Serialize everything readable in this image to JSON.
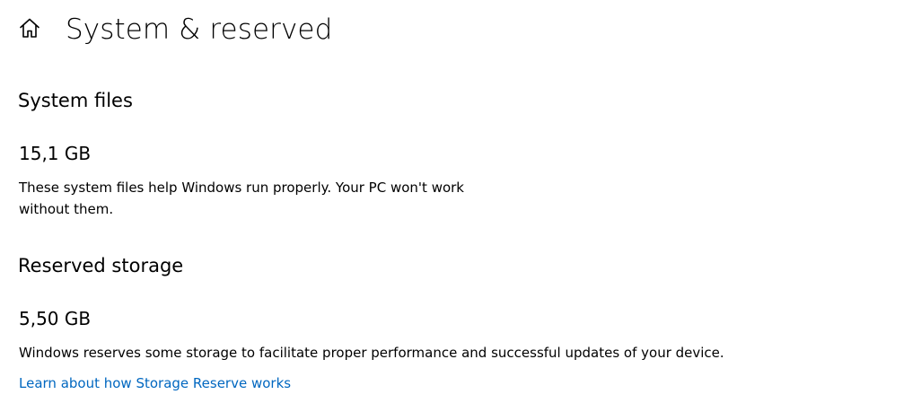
{
  "header": {
    "home_icon": "home-icon",
    "title": "System & reserved"
  },
  "system_files": {
    "title": "System files",
    "size": "15,1 GB",
    "description": "These system files help Windows run properly. Your PC won't work without them."
  },
  "reserved_storage": {
    "title": "Reserved storage",
    "size": "5,50 GB",
    "description": "Windows reserves some storage to facilitate proper performance and successful updates of your device.",
    "link_label": "Learn about how Storage Reserve works"
  },
  "colors": {
    "link": "#0067c0",
    "text": "#000000",
    "background": "#ffffff"
  }
}
